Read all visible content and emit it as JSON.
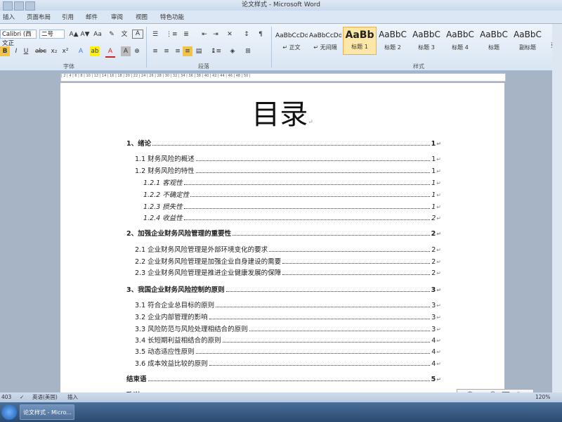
{
  "window": {
    "title": "论文样式 - Microsoft Word"
  },
  "tabs": [
    "插入",
    "页面布局",
    "引用",
    "邮件",
    "审阅",
    "视图",
    "特色功能"
  ],
  "ribbon": {
    "font_name": "Calibri (西文正",
    "font_size": "二号",
    "groups": {
      "font": "字体",
      "paragraph": "段落",
      "styles": "样式"
    },
    "styles": [
      {
        "sample": "AaBbCcDd",
        "name": "↵ 正文"
      },
      {
        "sample": "AaBbCcDd",
        "name": "↵ 无间隔"
      },
      {
        "sample": "AaBb",
        "name": "标题 1"
      },
      {
        "sample": "AaBbC",
        "name": "标题 2"
      },
      {
        "sample": "AaBbC",
        "name": "标题 3"
      },
      {
        "sample": "AaBbC",
        "name": "标题 4"
      },
      {
        "sample": "AaBbC",
        "name": "标题"
      },
      {
        "sample": "AaBbC",
        "name": "副标题"
      }
    ],
    "right_edge_label": "更改"
  },
  "document": {
    "title": "目录",
    "paragraph_mark": "↵",
    "toc": [
      {
        "level": 1,
        "text": "1、绪论",
        "page": "1"
      },
      {
        "level": 2,
        "text": "1.1 财务风险的概述",
        "page": "1"
      },
      {
        "level": 2,
        "text": "1.2 财务风险的特性",
        "page": "1"
      },
      {
        "level": 3,
        "text": "1.2.1 客观性",
        "page": "1"
      },
      {
        "level": 3,
        "text": "1.2.2 不确定性",
        "page": "1"
      },
      {
        "level": 3,
        "text": "1.2.3 损失性",
        "page": "1"
      },
      {
        "level": 3,
        "text": "1.2.4 收益性",
        "page": "2"
      },
      {
        "level": 1,
        "text": "2、加强企业财务风险管理的重要性",
        "page": "2"
      },
      {
        "level": 2,
        "text": "2.1 企业财务风险管理是外部环境变化的要求",
        "page": "2"
      },
      {
        "level": 2,
        "text": "2.2 企业财务风险管理是加强企业自身建设的需要",
        "page": "2"
      },
      {
        "level": 2,
        "text": "2.3 企业财务风险管理是推进企业健康发展的保障",
        "page": "2"
      },
      {
        "level": 1,
        "text": "3、我国企业财务风险控制的原则",
        "page": "3"
      },
      {
        "level": 2,
        "text": "3.1 符合企业总目标的原则",
        "page": "3"
      },
      {
        "level": 2,
        "text": "3.2 企业内部管理的影响",
        "page": "3"
      },
      {
        "level": 2,
        "text": "3.3 风险防范与风险处理相结合的原则",
        "page": "3"
      },
      {
        "level": 2,
        "text": "3.4 长短期利益相结合的原则",
        "page": "4"
      },
      {
        "level": 2,
        "text": "3.5 动态适应性原则",
        "page": "4"
      },
      {
        "level": 2,
        "text": "3.6 成本效益比较的原则",
        "page": "4"
      },
      {
        "level": 1,
        "text": "结束语",
        "page": "5"
      },
      {
        "level": 1,
        "text": "致谢",
        "page": ""
      }
    ]
  },
  "statusbar": {
    "page_info": "403",
    "language": "英语(美国)",
    "mode": "插入",
    "zoom": "120%"
  },
  "taskbar": {
    "word_task": "论文样式 - Micro..."
  },
  "ime": {
    "label": "中"
  }
}
